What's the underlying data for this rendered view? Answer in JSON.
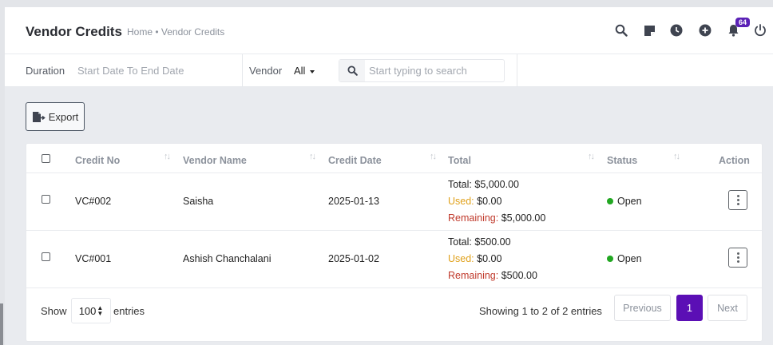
{
  "header": {
    "title": "Vendor Credits",
    "breadcrumb": "Home • Vendor Credits",
    "notification_count": "64"
  },
  "filters": {
    "duration_label": "Duration",
    "duration_placeholder": "Start Date To End Date",
    "vendor_label": "Vendor",
    "vendor_value": "All",
    "search_placeholder": "Start typing to search"
  },
  "toolbar": {
    "export_label": "Export"
  },
  "table": {
    "columns": [
      "Credit No",
      "Vendor Name",
      "Credit Date",
      "Total",
      "Status",
      "Action"
    ],
    "rows": [
      {
        "credit_no": "VC#002",
        "vendor": "Saisha",
        "date": "2025-01-13",
        "total_label": "Total:",
        "total": "$5,000.00",
        "used_label": "Used:",
        "used": "$0.00",
        "remaining_label": "Remaining:",
        "remaining": "$5,000.00",
        "status": "Open"
      },
      {
        "credit_no": "VC#001",
        "vendor": "Ashish Chanchalani",
        "date": "2025-01-02",
        "total_label": "Total:",
        "total": "$500.00",
        "used_label": "Used:",
        "used": "$0.00",
        "remaining_label": "Remaining:",
        "remaining": "$500.00",
        "status": "Open"
      }
    ]
  },
  "footer": {
    "show_label": "Show",
    "entries_value": "100",
    "entries_label": "entries",
    "info": "Showing 1 to 2 of 2 entries",
    "prev_label": "Previous",
    "page": "1",
    "next_label": "Next"
  },
  "colors": {
    "accent": "#5b0fb5",
    "badge": "#5b21b6",
    "used": "#e0a11b",
    "remaining": "#c0392b",
    "status_open": "#22a722"
  },
  "icons": [
    "search-icon",
    "note-icon",
    "clock-icon",
    "plus-circle-icon",
    "bell-icon",
    "power-icon",
    "export-file-icon",
    "sort-icon",
    "kebab-icon",
    "caret-down-icon"
  ]
}
